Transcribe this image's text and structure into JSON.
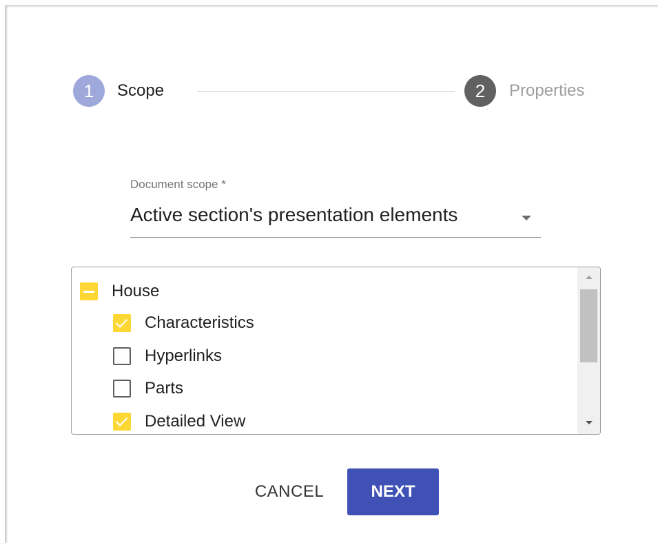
{
  "stepper": {
    "steps": [
      {
        "number": "1",
        "label": "Scope",
        "state": "active"
      },
      {
        "number": "2",
        "label": "Properties",
        "state": "inactive"
      }
    ]
  },
  "scope_field": {
    "label": "Document scope *",
    "value": "Active section's presentation elements"
  },
  "tree": {
    "items": [
      {
        "label": "House",
        "state": "indeterminate",
        "level": 0
      },
      {
        "label": "Characteristics",
        "state": "checked",
        "level": 1
      },
      {
        "label": "Hyperlinks",
        "state": "unchecked",
        "level": 1
      },
      {
        "label": "Parts",
        "state": "unchecked",
        "level": 1
      },
      {
        "label": "Detailed View",
        "state": "checked",
        "level": 1
      }
    ]
  },
  "actions": {
    "cancel_label": "CANCEL",
    "next_label": "NEXT"
  },
  "colors": {
    "primary": "#3f51b5",
    "step_active": "#9fa8da",
    "step_inactive": "#616161",
    "checkbox_checked": "#fdd835"
  }
}
